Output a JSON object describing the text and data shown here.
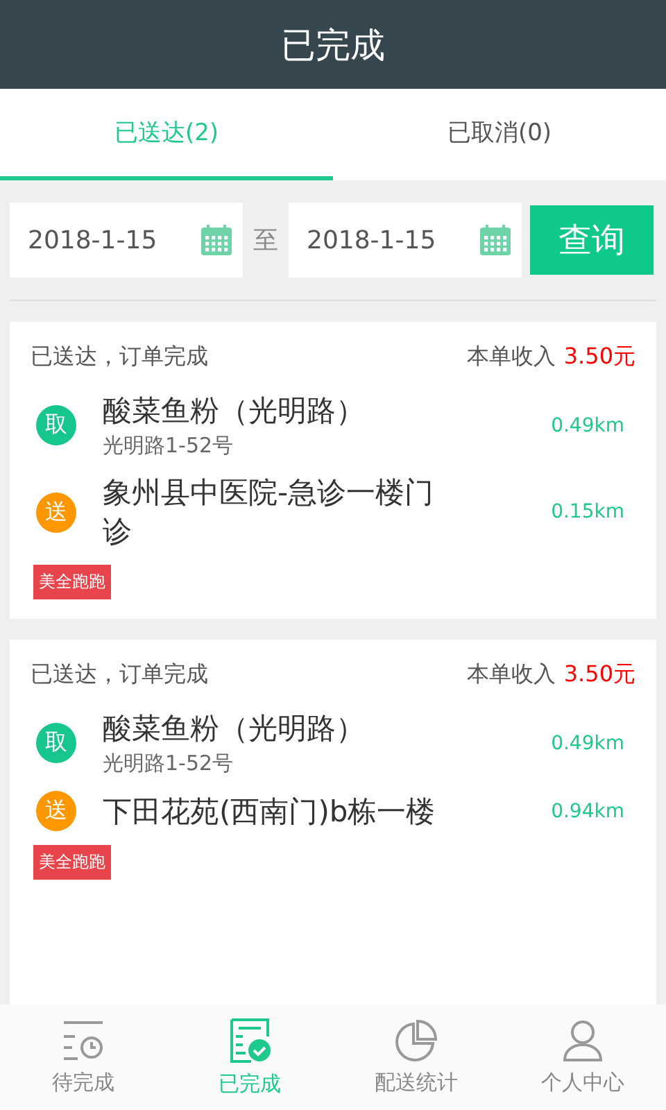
{
  "header": {
    "title": "已完成"
  },
  "tabs": [
    {
      "label": "已送达(2)",
      "selected": true
    },
    {
      "label": "已取消(0)",
      "selected": false
    }
  ],
  "filter": {
    "start_date": "2018-1-15",
    "separator": "至",
    "end_date": "2018-1-15",
    "query_button": "查询"
  },
  "orders": [
    {
      "status": "已送达，订单完成",
      "income_label": "本单收入",
      "income": "3.50元",
      "stops": [
        {
          "kind": "pickup",
          "badge": "取",
          "name": "酸菜鱼粉（光明路）",
          "address": "光明路1-52号",
          "distance": "0.49km"
        },
        {
          "kind": "delivery",
          "badge": "送",
          "name": "象州县中医院-急诊一楼门诊",
          "distance": "0.15km"
        }
      ],
      "tag": "美全跑跑"
    },
    {
      "status": "已送达，订单完成",
      "income_label": "本单收入",
      "income": "3.50元",
      "stops": [
        {
          "kind": "pickup",
          "badge": "取",
          "name": "酸菜鱼粉（光明路）",
          "address": "光明路1-52号",
          "distance": "0.49km"
        },
        {
          "kind": "delivery",
          "badge": "送",
          "name": "下田花苑(西南门)b栋一楼",
          "distance": "0.94km"
        }
      ],
      "tag": "美全跑跑"
    }
  ],
  "bottom_nav": [
    {
      "label": "待完成",
      "kind": "pending",
      "selected": false
    },
    {
      "label": "已完成",
      "kind": "done",
      "selected": true
    },
    {
      "label": "配送统计",
      "kind": "stats",
      "selected": false
    },
    {
      "label": "个人中心",
      "kind": "profile",
      "selected": false
    }
  ]
}
